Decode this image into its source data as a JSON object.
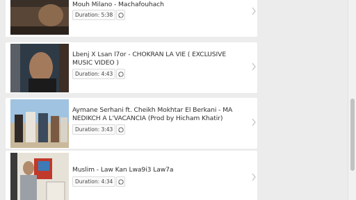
{
  "videos": [
    {
      "title": "Mouh Milano - Machafouhach",
      "duration": "Duration: 5:38"
    },
    {
      "title": "Lbenj X Lsan l7or - CHOKRAN LA VIE ( EXCLUSIVE MUSIC VIDEO )",
      "duration": "Duration: 4:43"
    },
    {
      "title": "Aymane Serhani ft. Cheikh Mokhtar El Berkani - MA NEDIKCH A L'VACANCIA (Prod by Hicham Khatir)",
      "duration": "Duration: 3:43"
    },
    {
      "title": "Muslim - Law Kan Lwa9i3 Law7a",
      "duration": "Duration: 4:34"
    }
  ],
  "icons": {
    "share": "whatsapp-icon",
    "open": "chevron-right-icon"
  },
  "colors": {
    "page_bg": "#ececec",
    "card_bg": "#ffffff",
    "text": "#2f2f2f",
    "chevron": "#c4c4c4"
  }
}
